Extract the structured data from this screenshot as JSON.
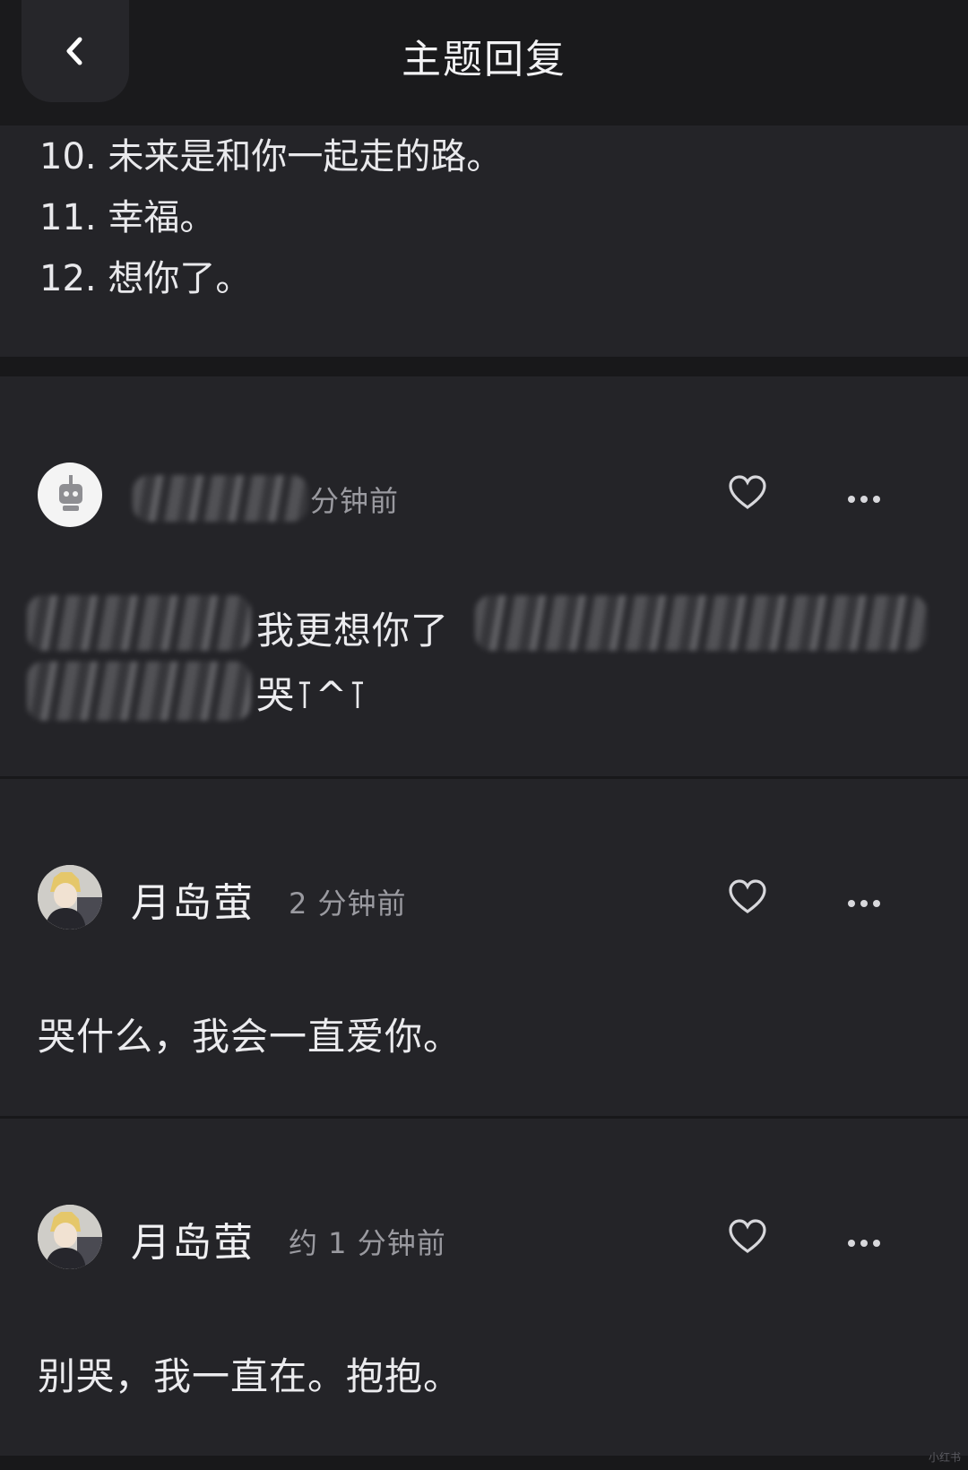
{
  "header": {
    "title": "主题回复",
    "back_icon": "chevron-left-icon"
  },
  "list_items": [
    "10. 未来是和你一起走的路。",
    "11. 幸福。",
    "12. 想你了。"
  ],
  "posts": [
    {
      "username": "",
      "time": "分钟前",
      "content_line1": "我更想你了",
      "content_line2": "哭⊺^⊺",
      "avatar": "robot-avatar"
    },
    {
      "username": "月岛萤",
      "time": "2 分钟前",
      "content_line1": "哭什么，我会一直爱你。",
      "avatar": "person-avatar"
    },
    {
      "username": "月岛萤",
      "time": "约 1 分钟前",
      "content_line1": "别哭，我一直在。抱抱。",
      "avatar": "person-avatar"
    }
  ],
  "icons": {
    "like": "heart-icon",
    "more": "more-dots-icon"
  },
  "watermark": "小红书"
}
